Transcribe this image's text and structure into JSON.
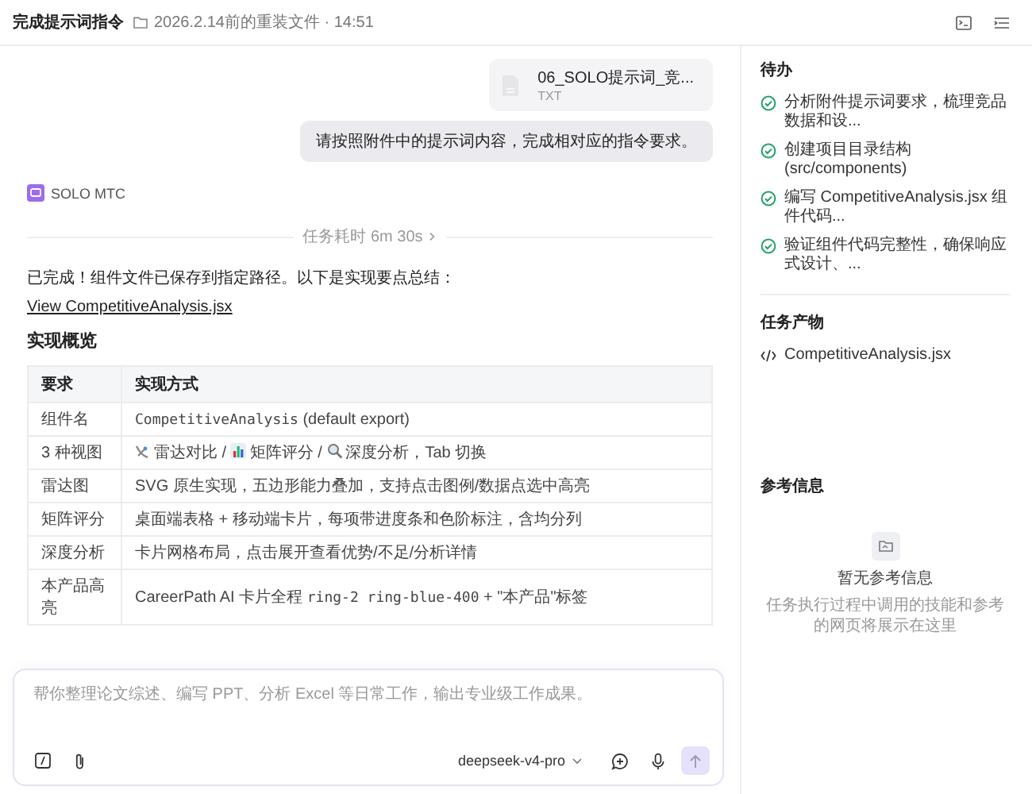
{
  "header": {
    "title": "完成提示词指令",
    "path": "2026.2.14前的重装文件 · 14:51"
  },
  "chat": {
    "attachment": {
      "name": "06_SOLO提示词_竞...",
      "type": "TXT"
    },
    "user_message": "请按照附件中的提示词内容，完成相对应的指令要求。",
    "agent": {
      "name": "SOLO MTC"
    },
    "duration": "任务耗时 6m 30s",
    "reply": "已完成！组件文件已保存到指定路径。以下是实现要点总结：",
    "file_link": "View CompetitiveAnalysis.jsx",
    "heading": "实现概览",
    "table": {
      "columns": [
        "要求",
        "实现方式"
      ],
      "rows": [
        {
          "label": "组件名",
          "parts": [
            {
              "kind": "code",
              "text": "CompetitiveAnalysis"
            },
            {
              "kind": "text",
              "text": " (default export)"
            }
          ]
        },
        {
          "label": "3 种视图",
          "parts": [
            {
              "kind": "radar",
              "text": "雷达对比 / "
            },
            {
              "kind": "chart",
              "text": "矩阵评分 / "
            },
            {
              "kind": "search",
              "text": "深度分析，Tab 切换"
            }
          ]
        },
        {
          "label": "雷达图",
          "parts": [
            {
              "kind": "text",
              "text": "SVG 原生实现，五边形能力叠加，支持点击图例/数据点选中高亮"
            }
          ]
        },
        {
          "label": "矩阵评分",
          "parts": [
            {
              "kind": "text",
              "text": "桌面端表格 + 移动端卡片，每项带进度条和色阶标注，含均分列"
            }
          ]
        },
        {
          "label": "深度分析",
          "parts": [
            {
              "kind": "text",
              "text": "卡片网格布局，点击展开查看优势/不足/分析详情"
            }
          ]
        },
        {
          "label": "本产品高亮",
          "parts": [
            {
              "kind": "text",
              "text": "CareerPath AI 卡片全程 "
            },
            {
              "kind": "code",
              "text": "ring-2 ring-blue-400"
            },
            {
              "kind": "text",
              "text": " + \"本产品\"标签"
            }
          ]
        }
      ]
    }
  },
  "composer": {
    "placeholder": "帮你整理论文综述、编写 PPT、分析 Excel 等日常工作，输出专业级工作成果。",
    "model": "deepseek-v4-pro",
    "send_enabled": false
  },
  "sidebar": {
    "todo": {
      "title": "待办",
      "items": [
        {
          "text": "分析附件提示词要求，梳理竞品数据和设...",
          "done": true
        },
        {
          "text": "创建项目目录结构 (src/components)",
          "done": true
        },
        {
          "text": "编写 CompetitiveAnalysis.jsx 组件代码...",
          "done": true
        },
        {
          "text": "验证组件代码完整性，确保响应式设计、...",
          "done": true
        }
      ]
    },
    "outputs": {
      "title": "任务产物",
      "files": [
        "CompetitiveAnalysis.jsx"
      ]
    },
    "references": {
      "title": "参考信息",
      "empty_title": "暂无参考信息",
      "empty_text": "任务执行过程中调用的技能和参考的网页将展示在这里"
    }
  }
}
